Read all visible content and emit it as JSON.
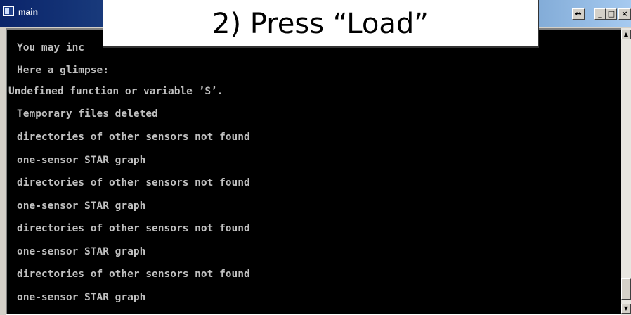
{
  "window": {
    "title": "main",
    "buttons": {
      "resize": "↔",
      "minimize": "_",
      "maximize": "□",
      "close": "×"
    }
  },
  "callout": {
    "text": "2) Press “Load”"
  },
  "console": {
    "lines": [
      "You may inc",
      "Here a glimpse:",
      "Undefined function or variable ’S’.",
      "Temporary files deleted",
      "directories of other sensors not found",
      "one-sensor STAR graph",
      "directories of other sensors not found",
      "one-sensor STAR graph",
      "directories of other sensors not found",
      "one-sensor STAR graph",
      "directories of other sensors not found",
      "one-sensor STAR graph"
    ]
  },
  "scrollbar": {
    "up": "▲",
    "down": "▼"
  },
  "colors": {
    "title_bar": "#0a246a",
    "console_bg": "#000000",
    "console_text": "#c0c0c0"
  }
}
